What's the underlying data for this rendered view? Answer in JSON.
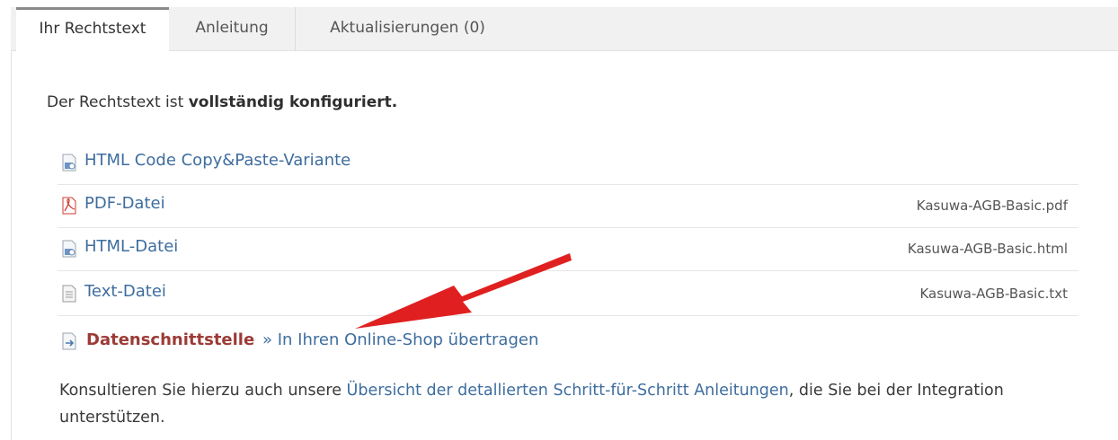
{
  "tabs": [
    {
      "label": "Ihr Rechtstext",
      "active": true
    },
    {
      "label": "Anleitung",
      "active": false
    },
    {
      "label": "Aktualisierungen (0)",
      "active": false
    }
  ],
  "status": {
    "prefix": "Der Rechtstext ist ",
    "strong": "vollständig konfiguriert."
  },
  "downloads": [
    {
      "label": "HTML Code Copy&Paste-Variante",
      "icon": "html-doc-icon",
      "file": ""
    },
    {
      "label": "PDF-Datei",
      "icon": "pdf-icon",
      "file": "Kasuwa-AGB-Basic.pdf"
    },
    {
      "label": "HTML-Datei",
      "icon": "html-doc-icon",
      "file": "Kasuwa-AGB-Basic.html"
    },
    {
      "label": "Text-Datei",
      "icon": "text-doc-icon",
      "file": "Kasuwa-AGB-Basic.txt"
    }
  ],
  "interface": {
    "label": "Datenschnittstelle",
    "link": "» In Ihren Online-Shop übertragen",
    "icon": "data-transfer-icon"
  },
  "info": {
    "before": "Konsultieren Sie hierzu auch unsere ",
    "link": "Übersicht der detallierten Schritt-für-Schritt Anleitungen",
    "after": ", die Sie bei der Integration unterstützen."
  },
  "colors": {
    "link": "#3e6d9e",
    "interface_label": "#9c3b36",
    "annotation_arrow": "#e02020"
  }
}
